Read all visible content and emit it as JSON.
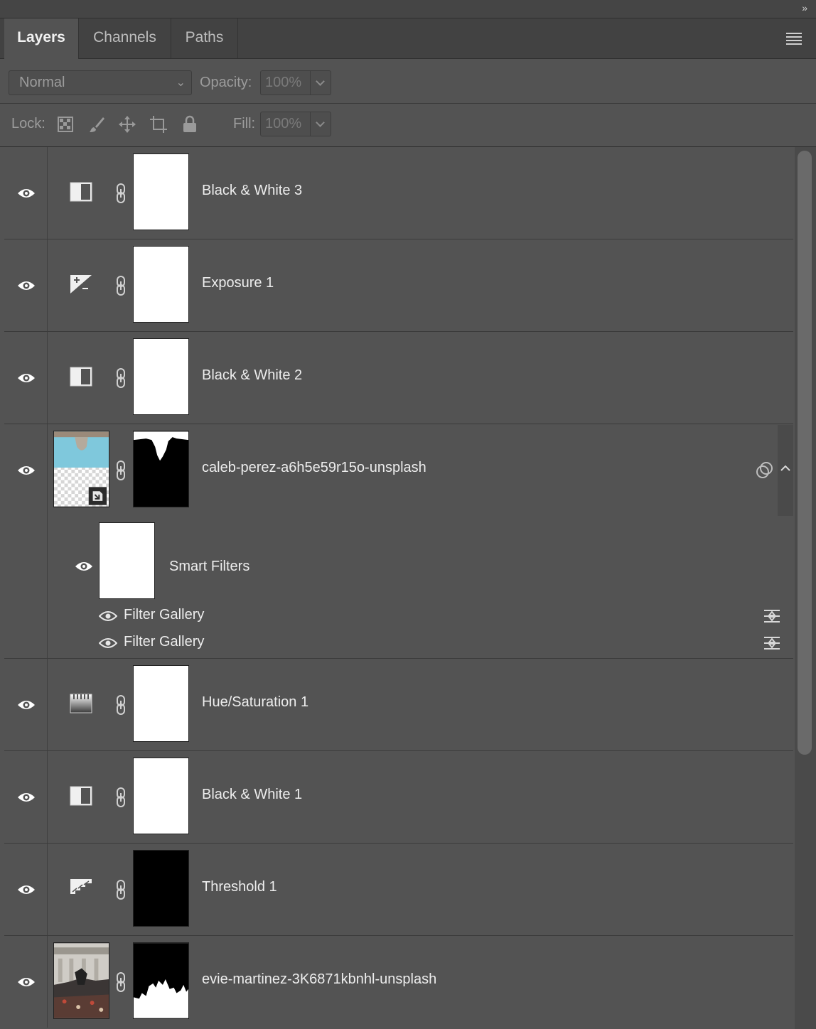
{
  "window": {
    "collapse_glyph": "»"
  },
  "tabs": [
    {
      "label": "Layers",
      "active": true
    },
    {
      "label": "Channels",
      "active": false
    },
    {
      "label": "Paths",
      "active": false
    }
  ],
  "blend": {
    "mode": "Normal",
    "opacity_label": "Opacity:",
    "opacity_value": "100%"
  },
  "lock": {
    "label": "Lock:",
    "fill_label": "Fill:",
    "fill_value": "100%"
  },
  "layers": [
    {
      "name": "Black & White 3",
      "icon": "black-white-icon",
      "mask": "white"
    },
    {
      "name": "Exposure 1",
      "icon": "exposure-icon",
      "mask": "white"
    },
    {
      "name": "Black & White 2",
      "icon": "black-white-icon",
      "mask": "white"
    },
    {
      "name": "caleb-perez-a6h5e59r15o-unsplash",
      "icon": "smart-object-thumbnail",
      "mask": "partial"
    },
    {
      "name": "Hue/Saturation 1",
      "icon": "hue-saturation-icon",
      "mask": "white"
    },
    {
      "name": "Black & White 1",
      "icon": "black-white-icon",
      "mask": "white"
    },
    {
      "name": "Threshold 1",
      "icon": "threshold-icon",
      "mask": "black"
    },
    {
      "name": "evie-martinez-3K6871kbnhl-unsplash",
      "icon": "photo-thumbnail",
      "mask": "partial"
    }
  ],
  "smart_filters": {
    "label": "Smart Filters",
    "filters": [
      {
        "name": "Filter Gallery"
      },
      {
        "name": "Filter Gallery"
      }
    ]
  }
}
